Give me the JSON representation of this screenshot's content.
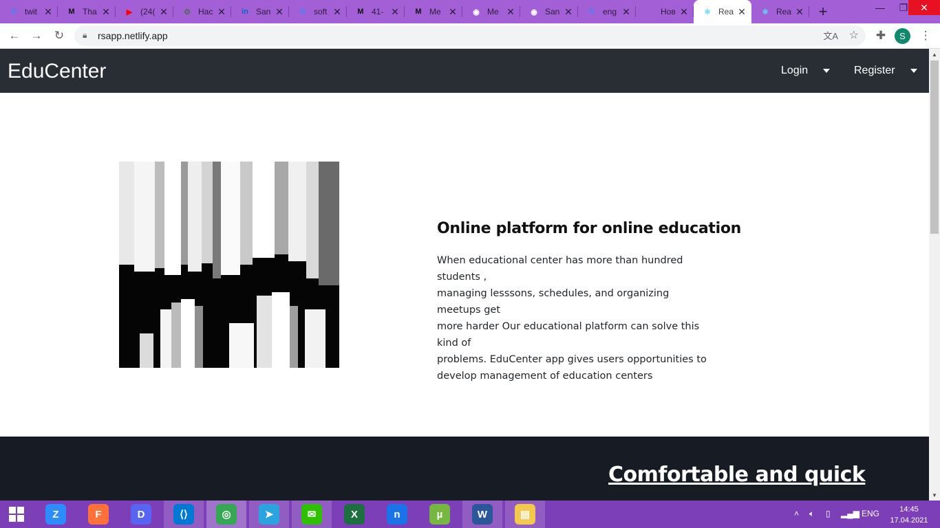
{
  "browser": {
    "tabs": [
      {
        "title": "twit",
        "icon": "google-icon",
        "color": "#4285f4",
        "glyph": "G"
      },
      {
        "title": "Tha",
        "icon": "medium-icon",
        "color": "#111111",
        "glyph": "M"
      },
      {
        "title": "(24(",
        "icon": "youtube-icon",
        "color": "#ff0000",
        "glyph": "▶"
      },
      {
        "title": "Нас",
        "icon": "gear-icon",
        "color": "#5f6368",
        "glyph": "⚙"
      },
      {
        "title": "San",
        "icon": "linkedin-icon",
        "color": "#0a66c2",
        "glyph": "in"
      },
      {
        "title": "soft",
        "icon": "google-icon",
        "color": "#4285f4",
        "glyph": "G"
      },
      {
        "title": "41-",
        "icon": "medium-icon",
        "color": "#111111",
        "glyph": "M"
      },
      {
        "title": "Me",
        "icon": "medium-icon",
        "color": "#111111",
        "glyph": "M"
      },
      {
        "title": "Me",
        "icon": "camera-icon",
        "color": "#ffffff",
        "glyph": "◉"
      },
      {
        "title": "San",
        "icon": "camera-icon",
        "color": "#ffffff",
        "glyph": "◉"
      },
      {
        "title": "eng",
        "icon": "google-icon",
        "color": "#4285f4",
        "glyph": "G"
      },
      {
        "title": "Новая в",
        "icon": "",
        "color": "#ffffff",
        "glyph": ""
      },
      {
        "title": "Rea",
        "icon": "react-icon",
        "color": "#61dafb",
        "glyph": "⚛",
        "active": true
      },
      {
        "title": "Rea",
        "icon": "react-icon",
        "color": "#61dafb",
        "glyph": "⚛"
      }
    ],
    "new_tab": "+",
    "url": "rsapp.netlify.app",
    "profile_initial": "S"
  },
  "navbar": {
    "brand": "EduCenter",
    "login": "Login",
    "register": "Register"
  },
  "hero": {
    "title": "Online platform for online education",
    "text_lines": [
      "When educational center has more than hundred students ,",
      "managing lesssons, schedules, and organizing meetups get",
      "more harder Our educational platform can solve this kind of",
      "problems. EduCenter app gives users opportunities to",
      "develop management of education centers"
    ]
  },
  "section2": {
    "title": "Comfortable and quick"
  },
  "taskbar": {
    "apps": [
      {
        "name": "zoom-icon",
        "color": "#2d8cff",
        "glyph": "Z"
      },
      {
        "name": "firefox-icon",
        "color": "#ff7139",
        "glyph": "F"
      },
      {
        "name": "discord-icon",
        "color": "#5865f2",
        "glyph": "D"
      },
      {
        "name": "vscode-icon",
        "color": "#0078d4",
        "glyph": "⟨⟩",
        "open": true
      },
      {
        "name": "chrome-icon",
        "color": "#34a853",
        "glyph": "◎",
        "open": true,
        "active": true
      },
      {
        "name": "telegram-icon",
        "color": "#2aa3df",
        "glyph": "➤",
        "open": true
      },
      {
        "name": "wechat-icon",
        "color": "#2dc100",
        "glyph": "✉",
        "open": true
      },
      {
        "name": "excel-icon",
        "color": "#1d6f42",
        "glyph": "X"
      },
      {
        "name": "notion-icon",
        "color": "#1a73e8",
        "glyph": "n"
      },
      {
        "name": "utorrent-icon",
        "color": "#76b83f",
        "glyph": "µ"
      },
      {
        "name": "word-icon",
        "color": "#2b579a",
        "glyph": "W",
        "open": true
      },
      {
        "name": "file-explorer-icon",
        "color": "#f4c84a",
        "glyph": "▤",
        "open": true
      }
    ],
    "lang": "ENG",
    "time": "14:45",
    "date": "17.04.2021"
  }
}
